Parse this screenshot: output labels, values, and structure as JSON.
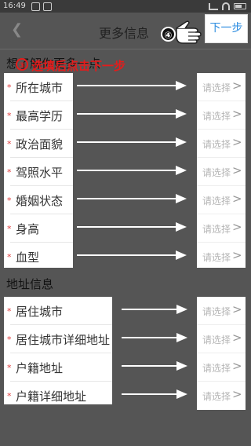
{
  "status_bar": {
    "time": "16:49"
  },
  "nav": {
    "back_icon": "chevron-left",
    "title": "更多信息",
    "next_label": "下一步"
  },
  "annotations": {
    "step4": "④",
    "step3_number": "③",
    "step3_text": "选填后点击下一步"
  },
  "section1": {
    "title": "想了解你更多一点",
    "fields": [
      {
        "label": "所在城市",
        "value": "请选择"
      },
      {
        "label": "最高学历",
        "value": "请选择"
      },
      {
        "label": "政治面貌",
        "value": "请选择"
      },
      {
        "label": "驾照水平",
        "value": "请选择"
      },
      {
        "label": "婚姻状态",
        "value": "请选择"
      },
      {
        "label": "身高",
        "value": "请选择"
      },
      {
        "label": "血型",
        "value": "请选择"
      }
    ]
  },
  "section2": {
    "title": "地址信息",
    "fields": [
      {
        "label": "居住城市",
        "value": "请选择"
      },
      {
        "label": "居住城市详细地址",
        "value": "请选择"
      },
      {
        "label": "户籍地址",
        "value": "请选择"
      },
      {
        "label": "户籍详细地址",
        "value": "请选择"
      }
    ]
  },
  "required_marker": "*",
  "chevron_glyph": ">",
  "colors": {
    "accent": "#2a8be0",
    "required": "#e03a3a",
    "annotation": "#e51b1b",
    "overlay": "#555555"
  }
}
